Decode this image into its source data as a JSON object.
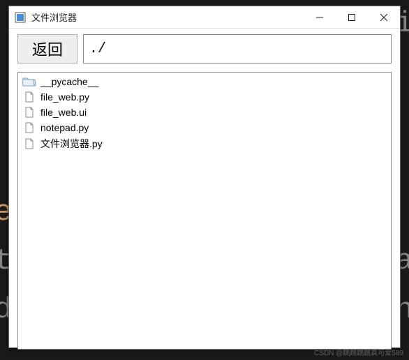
{
  "window": {
    "title": "文件浏览器"
  },
  "toolbar": {
    "back_label": "返回",
    "path_value": "./"
  },
  "files": [
    {
      "name": "__pycache__",
      "type": "folder"
    },
    {
      "name": "file_web.py",
      "type": "file"
    },
    {
      "name": "file_web.ui",
      "type": "file"
    },
    {
      "name": "notepad.py",
      "type": "file"
    },
    {
      "name": "文件浏览器.py",
      "type": "file"
    }
  ],
  "watermark": "CSDN @跳跳跳跳真可爱589"
}
